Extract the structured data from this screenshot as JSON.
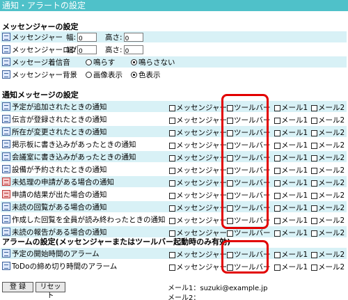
{
  "window": {
    "title": "通知・アラートの設定"
  },
  "messenger_section": {
    "title": "メッセンジャーの設定",
    "rows": [
      {
        "label": "メッセンジャー",
        "width_label": "幅:",
        "width_value": "0",
        "height_label": "高さ:",
        "height_value": "0"
      },
      {
        "label": "メッセンジャーログ",
        "width_label": "幅:",
        "width_value": "0",
        "height_label": "高さ:",
        "height_value": "0"
      },
      {
        "label": "メッセージ着信音",
        "option1": "鳴らす",
        "option2": "鳴らさない",
        "selected": "鳴らさない"
      },
      {
        "label": "メッセンジャー背景",
        "option1": "画像表示",
        "option2": "色表示",
        "selected": "色表示"
      }
    ]
  },
  "notify_section": {
    "title": "通知メッセージの設定",
    "columns": [
      "メッセンジャー",
      "ツールバー",
      "メール1",
      "メール2"
    ],
    "rows": [
      {
        "label": "予定が追加されたときの通知",
        "icon": "calendar-icon"
      },
      {
        "label": "伝言が登録されたときの通知",
        "icon": "memo-icon"
      },
      {
        "label": "所在が変更されたときの通知",
        "icon": "pen-icon"
      },
      {
        "label": "掲示板に書き込みがあったときの通知",
        "icon": "board-icon"
      },
      {
        "label": "会議室に書き込みがあったときの通知",
        "icon": "meeting-icon"
      },
      {
        "label": "設備が予約されたときの通知",
        "icon": "facility-icon"
      },
      {
        "label": "未処理の申請がある場合の通知",
        "icon": "request-icon"
      },
      {
        "label": "申請の結果が出た場合の通知",
        "icon": "request-result-icon"
      },
      {
        "label": "未読の回覧がある場合の通知",
        "icon": "circular-icon"
      },
      {
        "label": "作成した回覧を全員が読み終わったときの通知",
        "icon": "circular-done-icon"
      },
      {
        "label": "未読の報告がある場合の通知",
        "icon": "report-icon"
      }
    ]
  },
  "alarm_section": {
    "title": "アラームの設定(メッセンジャーまたはツールバー起動時のみ有効)",
    "columns": [
      "メッセンジャー",
      "ツールバー",
      "メール1",
      "メール2"
    ],
    "rows": [
      {
        "label": "予定の開始時間のアラーム",
        "icon": "schedule-alarm-icon"
      },
      {
        "label": "ToDoの締め切り時間のアラーム",
        "icon": "todo-alarm-icon"
      }
    ]
  },
  "footer": {
    "save_label": "登 録",
    "reset_label": "リセット",
    "mail1": "メール1：suzuki@example.jp",
    "mail2": "メール2："
  },
  "colors": {
    "title_bg": "#4fc1c9",
    "row_alt": "#d8f1f6",
    "highlight": "#e20000"
  }
}
